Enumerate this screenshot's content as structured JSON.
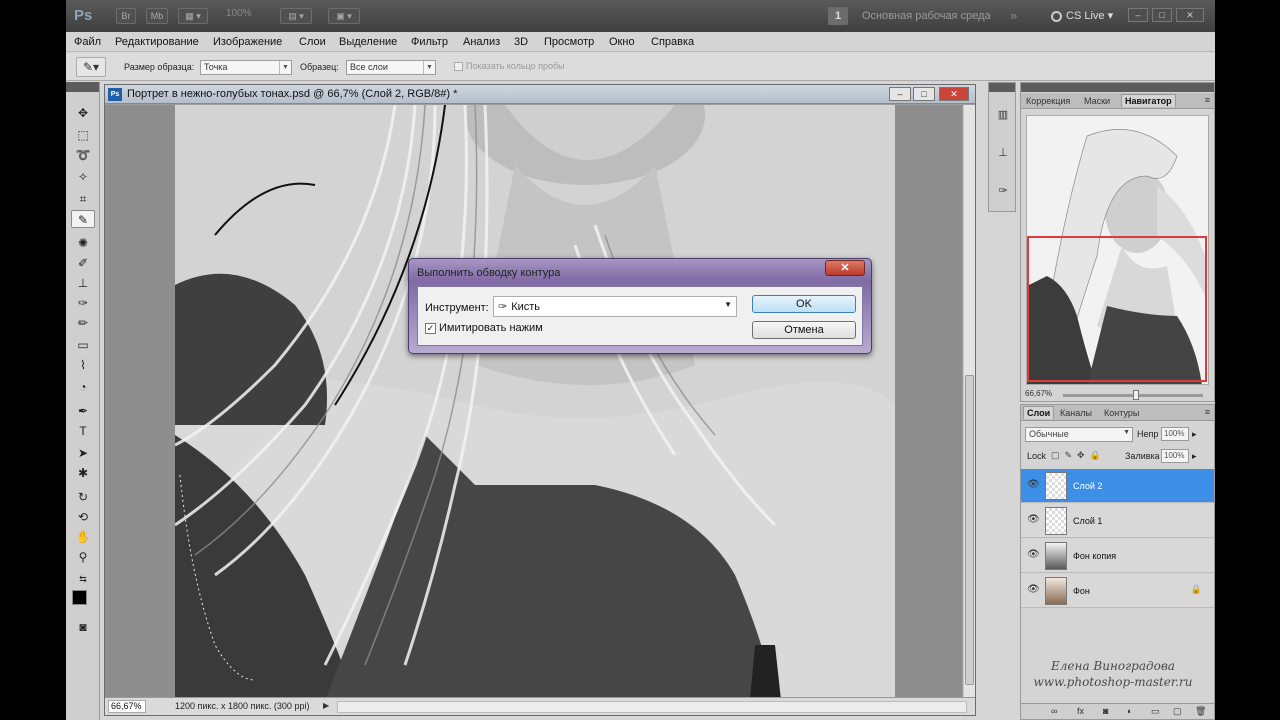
{
  "app": {
    "logo": "Ps",
    "top_buttons": [
      "Br",
      "Mb"
    ],
    "zoom": "100%",
    "workspace_number": "1",
    "workspace_label": "Основная рабочая среда",
    "more": "»",
    "cs_live": "CS Live ▾",
    "window_controls": [
      "–",
      "□",
      "✕"
    ]
  },
  "menu": {
    "items": [
      "Файл",
      "Редактирование",
      "Изображение",
      "Слои",
      "Выделение",
      "Фильтр",
      "Анализ",
      "3D",
      "Просмотр",
      "Окно",
      "Справка"
    ]
  },
  "options": {
    "sample_size_label": "Размер образца:",
    "sample_size_value": "Точка",
    "sample_label": "Образец:",
    "sample_value": "Все слои",
    "show_ring_label": "Показать кольцо пробы"
  },
  "document": {
    "title": "Портрет в нежно-голубых тонах.psd @ 66,7% (Слой 2, RGB/8#) *",
    "ps_badge": "Ps",
    "zoom": "66,67%",
    "info": "1200 пикс. x 1800 пикс. (300 ppi)",
    "controls": [
      "–",
      "□",
      "✕"
    ]
  },
  "dialog": {
    "title": "Выполнить обводку контура",
    "close": "✕",
    "tool_label": "Инструмент:",
    "tool_value": "Кисть",
    "simulate_label": "Имитировать нажим",
    "simulate_checked": true,
    "ok": "OK",
    "cancel": "Отмена"
  },
  "navigator": {
    "tabs": [
      "Коррекция",
      "Маски",
      "Навигатор"
    ],
    "active_tab": "Навигатор",
    "zoom": "66,67%"
  },
  "layers": {
    "tabs": [
      "Слои",
      "Каналы",
      "Контуры"
    ],
    "blend_mode": "Обычные",
    "opacity_label": "Непр",
    "opacity": "100%",
    "lock_label": "Lock",
    "fill_label": "Заливка",
    "fill": "100%",
    "items": [
      {
        "name": "Слой 2",
        "selected": true,
        "type": "transparent"
      },
      {
        "name": "Слой 1",
        "selected": false,
        "type": "transparent"
      },
      {
        "name": "Фон копия",
        "selected": false,
        "type": "bw"
      },
      {
        "name": "Фон",
        "selected": false,
        "type": "photo",
        "locked": true
      }
    ]
  },
  "watermark": {
    "line1": "Елена Виноградова",
    "line2": "www.photoshop-master.ru"
  },
  "colors": {
    "selected_layer": "#3d8ee6",
    "dialog_frame": "#7f6aa5",
    "close_button": "#c9453a",
    "nav_view_box": "#e03a3a"
  }
}
